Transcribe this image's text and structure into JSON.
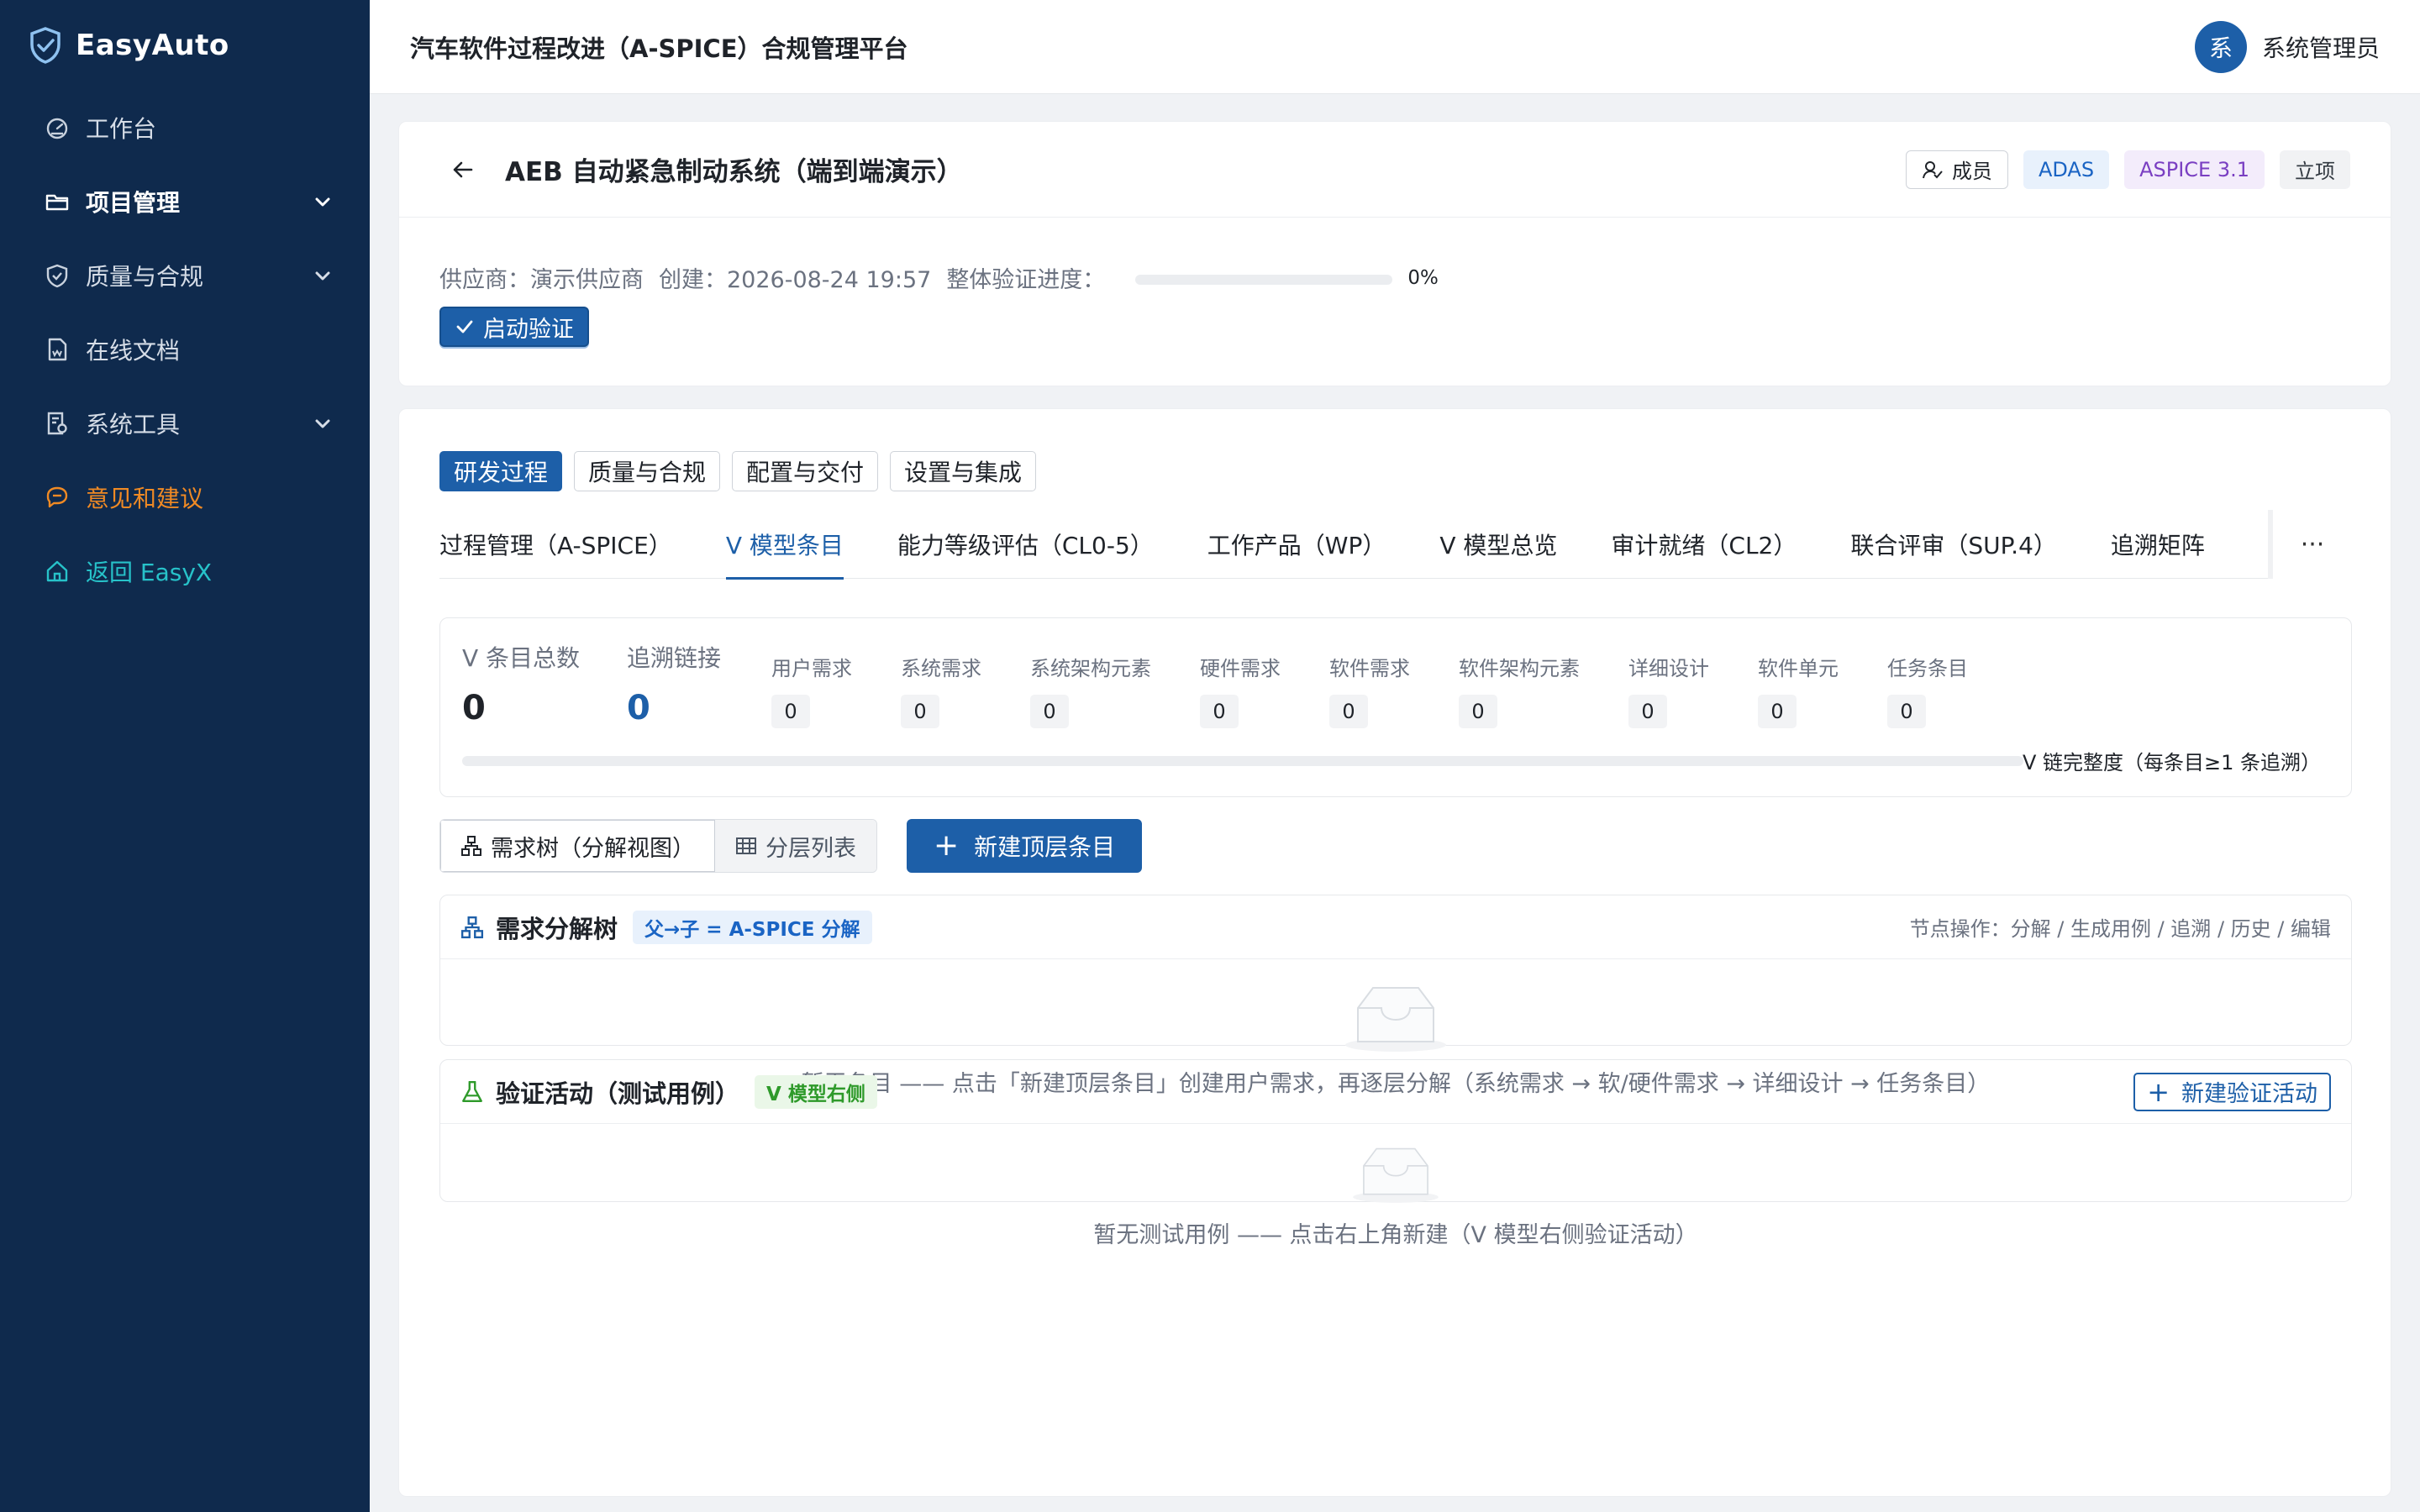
{
  "brand": {
    "name": "EasyAuto"
  },
  "sidebar": {
    "items": [
      {
        "label": "工作台",
        "icon": "dashboard-icon"
      },
      {
        "label": "项目管理",
        "icon": "folder-icon"
      },
      {
        "label": "质量与合规",
        "icon": "shield-icon"
      },
      {
        "label": "在线文档",
        "icon": "document-icon"
      },
      {
        "label": "系统工具",
        "icon": "tools-icon"
      },
      {
        "label": "意见和建议",
        "icon": "chat-icon"
      },
      {
        "label": "返回 EasyX",
        "icon": "home-icon"
      }
    ]
  },
  "header": {
    "title": "汽车软件过程改进（A-SPICE）合规管理平台",
    "user_avatar": "系",
    "user_name": "系统管理员"
  },
  "project": {
    "title": "AEB 自动紧急制动系统（端到端演示）",
    "member_label": "成员",
    "tag_domain": "ADAS",
    "tag_standard": "ASPICE 3.1",
    "tag_stage": "立项",
    "supplier": "供应商：演示供应商",
    "created": "创建：2026-08-24 19:57",
    "progress_label": "整体验证进度：",
    "progress_value": 0,
    "progress_pct": "0%",
    "start_button": "启动验证"
  },
  "category_tabs": [
    "研发过程",
    "质量与合规",
    "配置与交付",
    "设置与集成"
  ],
  "sub_tabs": [
    "过程管理（A-SPICE）",
    "V 模型条目",
    "能力等级评估（CL0-5）",
    "工作产品（WP）",
    "V 模型总览",
    "审计就绪（CL2）",
    "联合评审（SUP.4）",
    "追溯矩阵"
  ],
  "sub_more": "···",
  "stats": {
    "total_label": "V 条目总数",
    "total_value": "0",
    "links_label": "追溯链接",
    "links_value": "0",
    "levels": [
      {
        "label": "用户需求",
        "value": "0"
      },
      {
        "label": "系统需求",
        "value": "0"
      },
      {
        "label": "系统架构元素",
        "value": "0"
      },
      {
        "label": "硬件需求",
        "value": "0"
      },
      {
        "label": "软件需求",
        "value": "0"
      },
      {
        "label": "软件架构元素",
        "value": "0"
      },
      {
        "label": "详细设计",
        "value": "0"
      },
      {
        "label": "软件单元",
        "value": "0"
      },
      {
        "label": "任务条目",
        "value": "0"
      }
    ],
    "completeness_label": "V 链完整度（每条目≥1 条追溯）",
    "completeness_value": 0
  },
  "view": {
    "tree_label": "需求树（分解视图）",
    "list_label": "分层列表",
    "new_top_label": "新建顶层条目"
  },
  "tree_panel": {
    "title": "需求分解树",
    "badge": "父→子 = A-SPICE 分解",
    "hint": "节点操作：分解 / 生成用例 / 追溯 / 历史 / 编辑",
    "empty": "暂无条目 —— 点击「新建顶层条目」创建用户需求，再逐层分解（系统需求 → 软/硬件需求 → 详细设计 → 任务条目）"
  },
  "verify_panel": {
    "title": "验证活动（测试用例）",
    "badge": "V 模型右侧",
    "new_label": "新建验证活动",
    "empty": "暂无测试用例 —— 点击右上角新建（V 模型右侧验证活动）"
  },
  "colors": {
    "sidebar_bg": "#0f2a4d",
    "primary": "#1d5fa8",
    "feedback": "#f08a24",
    "back": "#27c2c9"
  }
}
